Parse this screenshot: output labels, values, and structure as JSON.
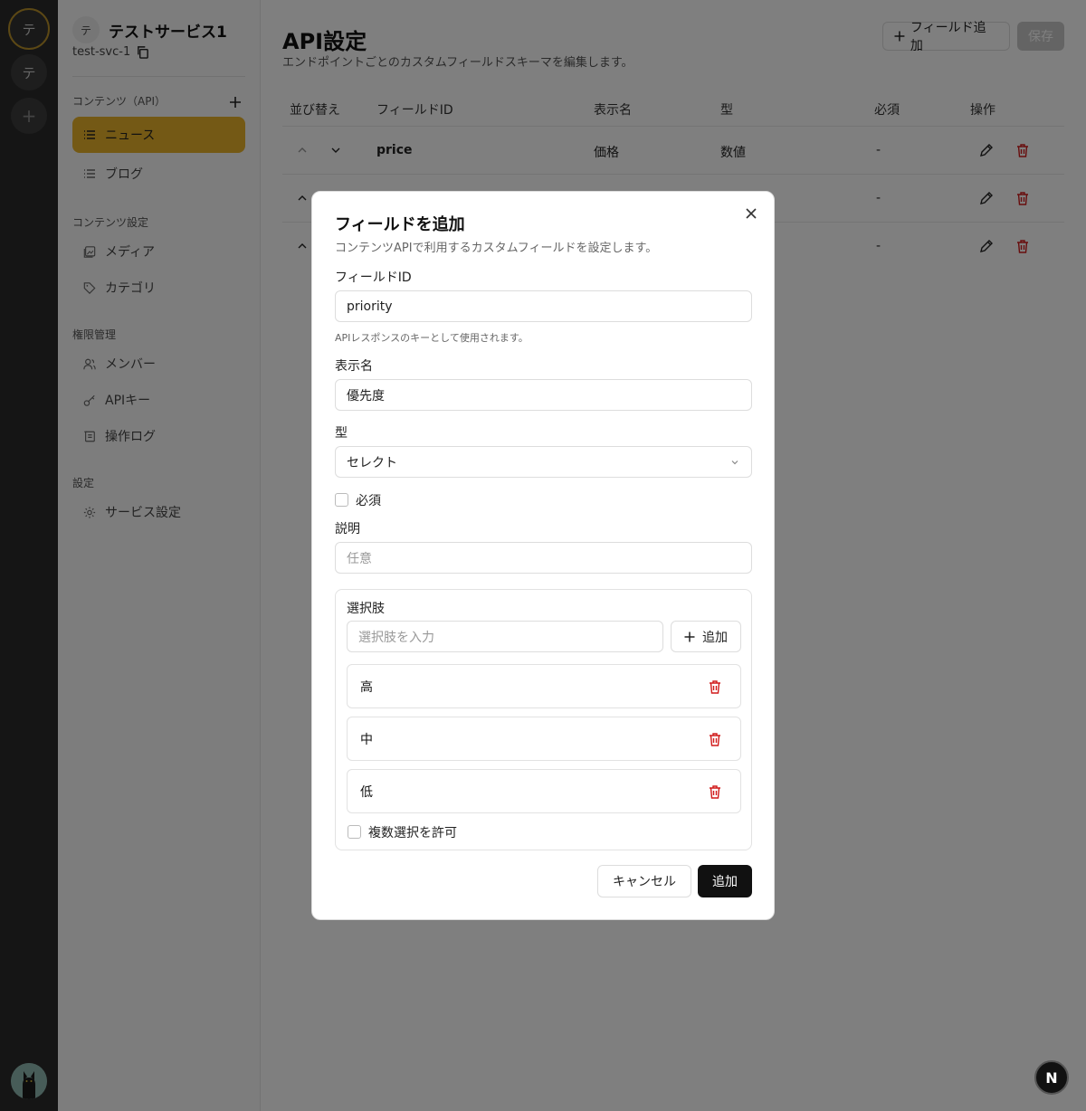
{
  "rail": {
    "items": [
      {
        "label": "テ"
      },
      {
        "label": "テ"
      },
      {
        "label": "+"
      }
    ]
  },
  "sidebar": {
    "service_avatar": "テ",
    "service_name": "テストサービス1",
    "service_id": "test-svc-1",
    "sections": [
      {
        "label": "コンテンツ（API）"
      },
      {
        "label": "コンテンツ設定"
      },
      {
        "label": "権限管理"
      },
      {
        "label": "設定"
      }
    ],
    "items": [
      {
        "label": "ニュース",
        "icon": "list-icon"
      },
      {
        "label": "ブログ",
        "icon": "list-icon"
      },
      {
        "label": "メディア",
        "icon": "image-icon"
      },
      {
        "label": "カテゴリ",
        "icon": "tag-icon"
      },
      {
        "label": "メンバー",
        "icon": "users-icon"
      },
      {
        "label": "APIキー",
        "icon": "key-icon"
      },
      {
        "label": "操作ログ",
        "icon": "log-icon"
      },
      {
        "label": "サービス設定",
        "icon": "gear-icon"
      }
    ]
  },
  "main": {
    "title": "API設定",
    "subtitle": "エンドポイントごとのカスタムフィールドスキーマを編集します。",
    "add_field_label": "フィールド追加",
    "save_label": "保存",
    "table": {
      "headers": [
        "並び替え",
        "フィールドID",
        "表示名",
        "型",
        "必須",
        "操作"
      ],
      "rows": [
        {
          "field_id": "price",
          "display_name": "価格",
          "type": "数値",
          "required": "-"
        },
        {
          "field_id": "",
          "display_name": "",
          "type": "",
          "required": "-"
        },
        {
          "field_id": "",
          "display_name": "",
          "type": "",
          "required": "-"
        }
      ]
    }
  },
  "dialog": {
    "title": "フィールドを追加",
    "description": "コンテンツAPIで利用するカスタムフィールドを設定します。",
    "field_id_label": "フィールドID",
    "field_id_value": "priority",
    "field_id_help": "APIレスポンスのキーとして使用されます。",
    "display_name_label": "表示名",
    "display_name_value": "優先度",
    "type_label": "型",
    "type_value": "セレクト",
    "required_label": "必須",
    "description_label": "説明",
    "description_placeholder": "任意",
    "options_label": "選択肢",
    "options_placeholder": "選択肢を入力",
    "options_add_label": "追加",
    "options": [
      "高",
      "中",
      "低"
    ],
    "multi_label": "複数選択を許可",
    "cancel_label": "キャンセル",
    "submit_label": "追加"
  },
  "colors": {
    "accent": "#e8b32a",
    "danger": "#d11a1a",
    "primary_button": "#111111"
  }
}
